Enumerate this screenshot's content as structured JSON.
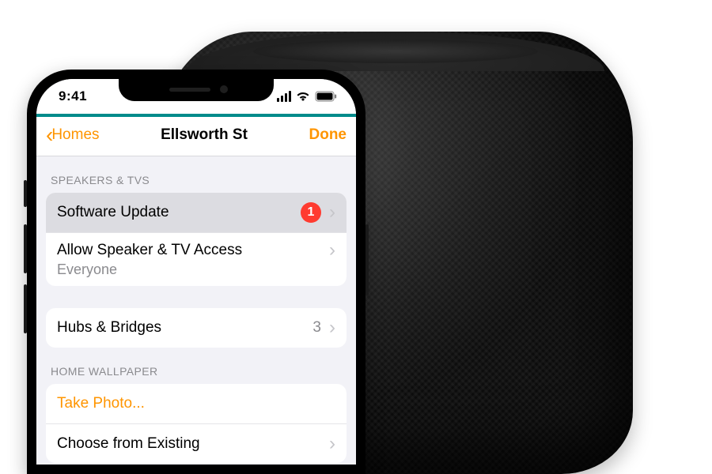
{
  "statusbar": {
    "time": "9:41"
  },
  "nav": {
    "back": "Homes",
    "title": "Ellsworth St",
    "done": "Done"
  },
  "sections": {
    "speakers_header": "SPEAKERS & TVS",
    "software_update": {
      "label": "Software Update",
      "badge": "1"
    },
    "access": {
      "label": "Allow Speaker & TV Access",
      "value": "Everyone"
    },
    "hubs": {
      "label": "Hubs & Bridges",
      "count": "3"
    },
    "wallpaper_header": "HOME WALLPAPER",
    "take_photo": "Take Photo...",
    "choose_existing": "Choose from Existing"
  }
}
